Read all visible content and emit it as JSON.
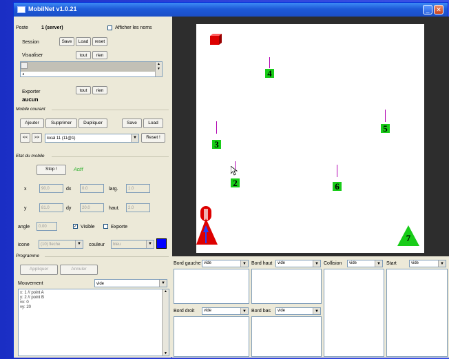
{
  "title": "MobilNet v1.0.21",
  "colors": {
    "accent": "#1f5cd8",
    "swatch": "#0000ff",
    "robot": "#18cc18",
    "selected": "#dd0000"
  },
  "left": {
    "poste_label": "Poste",
    "poste_value": "1 (server)",
    "show_names": "Afficher les noms",
    "session_label": "Session",
    "session_save": "Save",
    "session_load": "Load",
    "session_reset": "reset",
    "visualiser_label": "Visualiser",
    "visualiser_all": "tout",
    "visualiser_none": "rien",
    "exporter_label": "Exporter",
    "exporter_all": "tout",
    "exporter_none": "rien",
    "exporter_value": "aucun",
    "mobile_section": "Mobile courant",
    "add": "Ajouter",
    "delete": "Supprimer",
    "duplicate": "Dupliquer",
    "mobile_save": "Save",
    "mobile_load": "Load",
    "prev": "<<",
    "next": ">>",
    "mobile_select": "local 11 (11@1)",
    "reset": "Reset !",
    "state_section": "Etat du mobile",
    "stop": "Stop !",
    "active": "Actif",
    "x_label": "x",
    "x_value": "90.0",
    "dx_label": "dx",
    "dx_value": "0.0",
    "larg_label": "larg.",
    "larg_value": "1.0",
    "y_label": "y",
    "y_value": "81.0",
    "dy_label": "dy",
    "dy_value": "20.0",
    "haut_label": "haut.",
    "haut_value": "2.0",
    "angle_label": "angle",
    "angle_value": "0.00",
    "visible": "Visible",
    "exporte": "Exporte",
    "icone_label": "icone",
    "icone_value": "(10) fleche",
    "couleur_label": "couleur",
    "couleur_value": "bleu",
    "program_section": "Programme",
    "apply": "Appliquer",
    "cancel": "Annuler",
    "movement_label": "Mouvement",
    "movement_value": "vide",
    "code_lines": [
      "x: 1 // point A",
      "y: 2 // point B",
      "vx: 0",
      "vy: 20"
    ]
  },
  "robots": [
    {
      "label": "4"
    },
    {
      "label": "5"
    },
    {
      "label": "3"
    },
    {
      "label": "2"
    },
    {
      "label": "6"
    },
    {
      "label": "7"
    }
  ],
  "bottom": {
    "bord_gauche": "Bord gauche",
    "bord_gauche_value": "vide",
    "bord_haut": "Bord haut",
    "bord_haut_value": "vide",
    "collision": "Collision",
    "collision_value": "vide",
    "start": "Start",
    "start_value": "vide",
    "bord_droit": "Bord droit",
    "bord_droit_value": "vide",
    "bord_bas": "Bord bas",
    "bord_bas_value": "vide"
  }
}
